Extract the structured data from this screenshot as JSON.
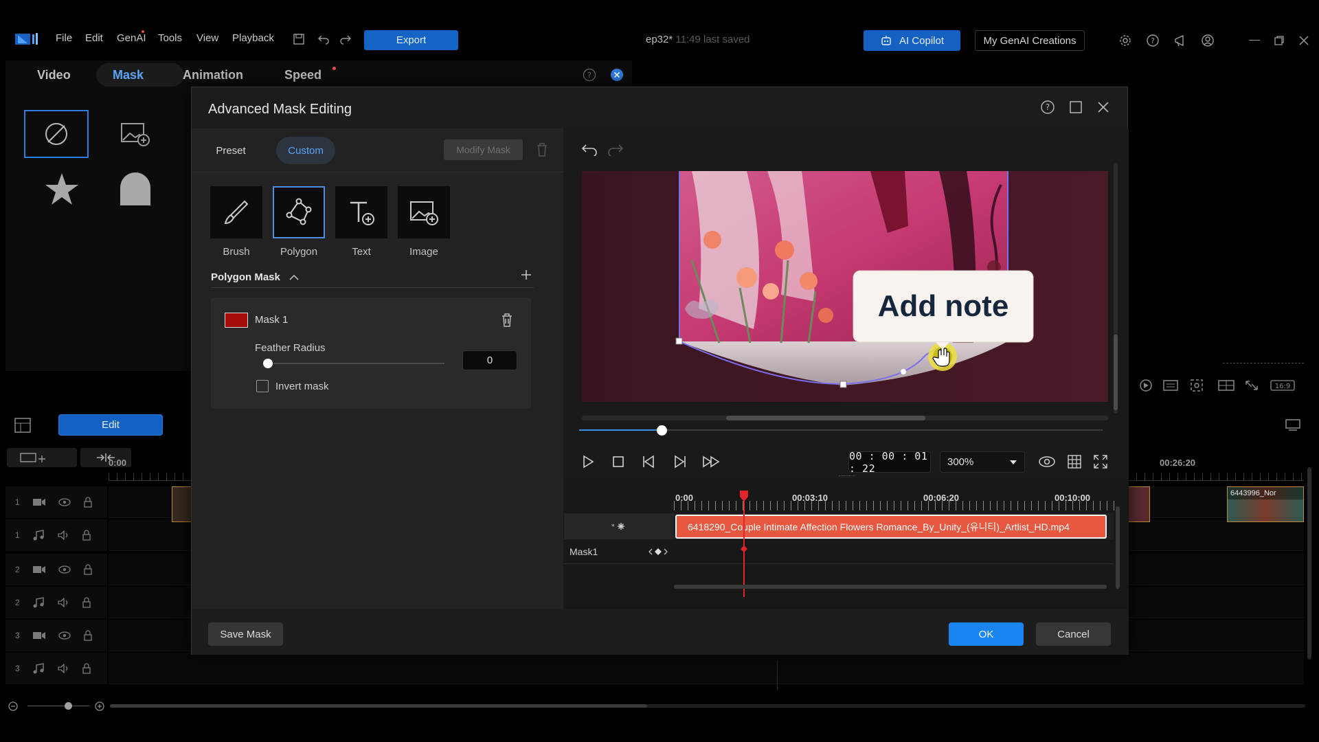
{
  "app": {
    "menu": [
      "File",
      "Edit",
      "GenAI",
      "Tools",
      "View",
      "Playback"
    ],
    "export_label": "Export",
    "project_name": "ep32*",
    "project_saved": "11:49 last saved",
    "ai_copilot_label": "AI Copilot",
    "my_genai_label": "My GenAI Creations",
    "accent_color": "#1464c6"
  },
  "side_tabs": [
    "Video",
    "Mask",
    "Animation",
    "Speed"
  ],
  "timeline": {
    "edit_label": "Edit",
    "ruler_start": "0:00",
    "ruler_right": "00:26:20",
    "clip_right_label": "6443996_Nor",
    "tracks": [
      {
        "num": "1",
        "kind": "video"
      },
      {
        "num": "1",
        "kind": "audio"
      },
      {
        "num": "2",
        "kind": "video"
      },
      {
        "num": "2",
        "kind": "audio"
      },
      {
        "num": "3",
        "kind": "video"
      },
      {
        "num": "3",
        "kind": "audio"
      }
    ]
  },
  "preview_aspect": "16:9",
  "dialog": {
    "title": "Advanced Mask Editing",
    "preset_label": "Preset",
    "custom_label": "Custom",
    "modify_mask_label": "Modify Mask",
    "tools": [
      {
        "label": "Brush",
        "icon": "brush-icon"
      },
      {
        "label": "Polygon",
        "icon": "polygon-icon",
        "active": true
      },
      {
        "label": "Text",
        "icon": "text-add-icon"
      },
      {
        "label": "Image",
        "icon": "image-add-icon"
      }
    ],
    "polygon_mask_label": "Polygon Mask",
    "mask": {
      "name": "Mask 1",
      "color": "#a50b0b",
      "feather_label": "Feather Radius",
      "feather_value": "0",
      "invert_label": "Invert mask",
      "invert_checked": false
    },
    "overlay_note": "Add note",
    "timecode": "00 : 00 : 01 : 22",
    "zoom": "300%",
    "mini_timeline": {
      "ticks": [
        "0:00",
        "00:03:10",
        "00:06:20",
        "00:10:00"
      ],
      "clip_name": "6418290_Couple Intimate Affection Flowers Romance_By_Unity_(유니티)_Artlist_HD.mp4",
      "mask_track": "Mask1",
      "playhead_color": "#e3242b"
    },
    "save_mask_label": "Save Mask",
    "ok_label": "OK",
    "cancel_label": "Cancel"
  }
}
